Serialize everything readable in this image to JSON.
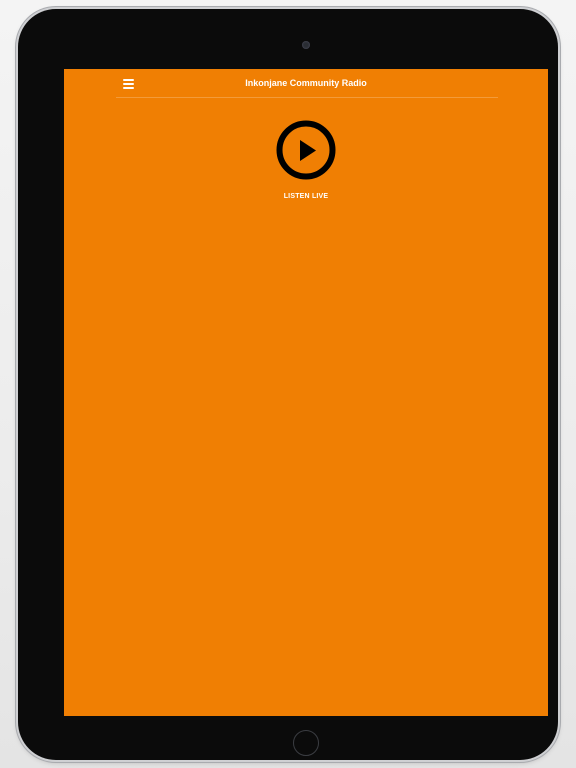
{
  "app": {
    "title": "Inkonjane Community Radio"
  },
  "nav": {
    "menu_icon": "hamburger-menu-icon"
  },
  "player": {
    "play_icon": "play-circle-icon",
    "listen_label": "LISTEN LIVE"
  },
  "colors": {
    "background": "#f07f03",
    "text": "#ffffff",
    "play_icon": "#000000"
  }
}
